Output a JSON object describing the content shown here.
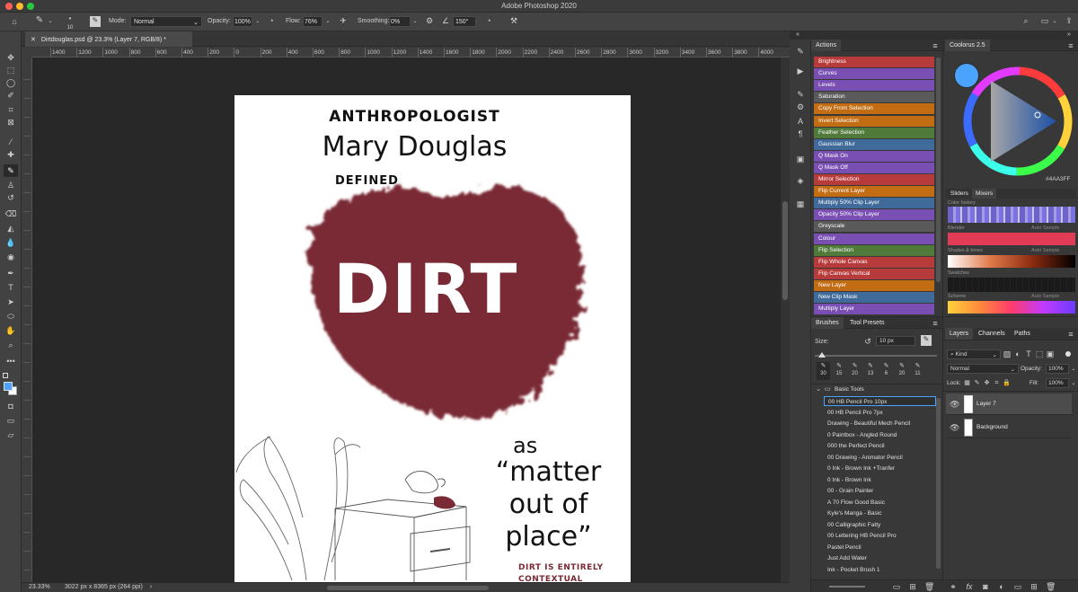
{
  "window": {
    "title": "Adobe Photoshop 2020"
  },
  "options": {
    "mode_label": "Mode:",
    "mode_value": "Normal",
    "opacity_label": "Opacity:",
    "opacity_value": "100%",
    "flow_label": "Flow:",
    "flow_value": "76%",
    "smoothing_label": "Smoothing:",
    "smoothing_value": "0%",
    "angle_value": "150°",
    "brush_size": "10"
  },
  "document": {
    "tab_title": "Dirtdouglas.psd @ 23.3% (Layer 7, RGB/8) *",
    "zoom": "23.33%",
    "info": "3022 px x 8365 px (264 ppi)"
  },
  "ruler": {
    "h_ticks": [
      "1400",
      "1200",
      "1000",
      "800",
      "600",
      "400",
      "200",
      "0",
      "200",
      "400",
      "600",
      "800",
      "1000",
      "1200",
      "1400",
      "1600",
      "1800",
      "2000",
      "2200",
      "2400",
      "2600",
      "2800",
      "3000",
      "3200",
      "3400",
      "3600",
      "3800",
      "4000"
    ]
  },
  "artwork": {
    "line1": "ANTHROPOLOGIST",
    "line2": "Mary Douglas",
    "line3": "DEFINED",
    "big": "DIRT",
    "as": "as",
    "q1": "“matter",
    "q2": "out of",
    "q3": "place”",
    "footer1": "DIRT IS ENTIRELY",
    "footer2": "CONTEXTUAL"
  },
  "actions": {
    "title": "Actions",
    "items": [
      {
        "label": "Brightness",
        "color": "#b83b3b"
      },
      {
        "label": "Curves",
        "color": "#7a4fb3"
      },
      {
        "label": "Levels",
        "color": "#7a4fb3"
      },
      {
        "label": "Saturation",
        "color": "#5a5a5a"
      },
      {
        "label": "Copy From Selection",
        "color": "#c26d14"
      },
      {
        "label": "Invert Selection",
        "color": "#c26d14"
      },
      {
        "label": "Feather Selection",
        "color": "#4f7a3a"
      },
      {
        "label": "Gaussian Blur",
        "color": "#3f6a9a"
      },
      {
        "label": "Q Mask On",
        "color": "#7a4fb3"
      },
      {
        "label": "Q Mask Off",
        "color": "#7a4fb3"
      },
      {
        "label": "Mirror Selection",
        "color": "#b83b3b"
      },
      {
        "label": "Flip Current Layer",
        "color": "#c26d14"
      },
      {
        "label": "Multiply 50% Clip Layer",
        "color": "#3f6a9a"
      },
      {
        "label": "Opacity 50% Clip Layer",
        "color": "#7a4fb3"
      },
      {
        "label": "Greyscale",
        "color": "#5a5a5a"
      },
      {
        "label": "Colour",
        "color": "#7a4fb3"
      },
      {
        "label": "Flip Selection",
        "color": "#4f7a3a"
      },
      {
        "label": "Flip Whole Canvas",
        "color": "#b83b3b"
      },
      {
        "label": "Flip Canvas Vertical",
        "color": "#b83b3b"
      },
      {
        "label": "New Layer",
        "color": "#c26d14"
      },
      {
        "label": "New Clip Mask",
        "color": "#3f6a9a"
      },
      {
        "label": "Multiply Layer",
        "color": "#7a4fb3"
      }
    ]
  },
  "coolorus": {
    "title": "Coolorus 2.5",
    "hex": "#4AA3FF",
    "tabs": [
      "Sliders",
      "Mixers"
    ],
    "labels": [
      "Color history",
      "Blender",
      "Shades & tones",
      "Swatches",
      "Scheme"
    ],
    "auto_sample": "Auto Sample"
  },
  "brushes": {
    "tabs": [
      "Brushes",
      "Tool Presets"
    ],
    "size_label": "Size:",
    "size_value": "10 px",
    "preset_sizes": [
      "30",
      "15",
      "20",
      "13",
      "6",
      "20",
      "11"
    ],
    "group": "Basic Tools",
    "items": [
      "00 HB Pencil Pro 10px",
      "00 HB Pencil Pro 7px",
      "Drawing - Beautiful Mech Pencil",
      "0 Paintbox - Angled Round",
      "000 the Perfect Pencil",
      "00 Drawing - Animator Pencil",
      "0 Ink - Brown Ink +Tranfer",
      "0 Ink - Brown Ink",
      "00 - Grain Painter",
      "A 70 Flow Good Basic",
      "Kyle's Manga - Basic",
      "00 Calligraphic Fatty",
      "00 Lettering HB Pencil Pro",
      "Pastel Pencil",
      "Just Add Water",
      "Ink -  Pocket Brush 1"
    ]
  },
  "layers": {
    "tabs": [
      "Layers",
      "Channels",
      "Paths"
    ],
    "kind": "Kind",
    "blend": "Normal",
    "opacity_label": "Opacity:",
    "opacity": "100%",
    "lock_label": "Lock:",
    "fill_label": "Fill:",
    "fill": "100%",
    "items": [
      "Layer 7",
      "Background"
    ]
  }
}
